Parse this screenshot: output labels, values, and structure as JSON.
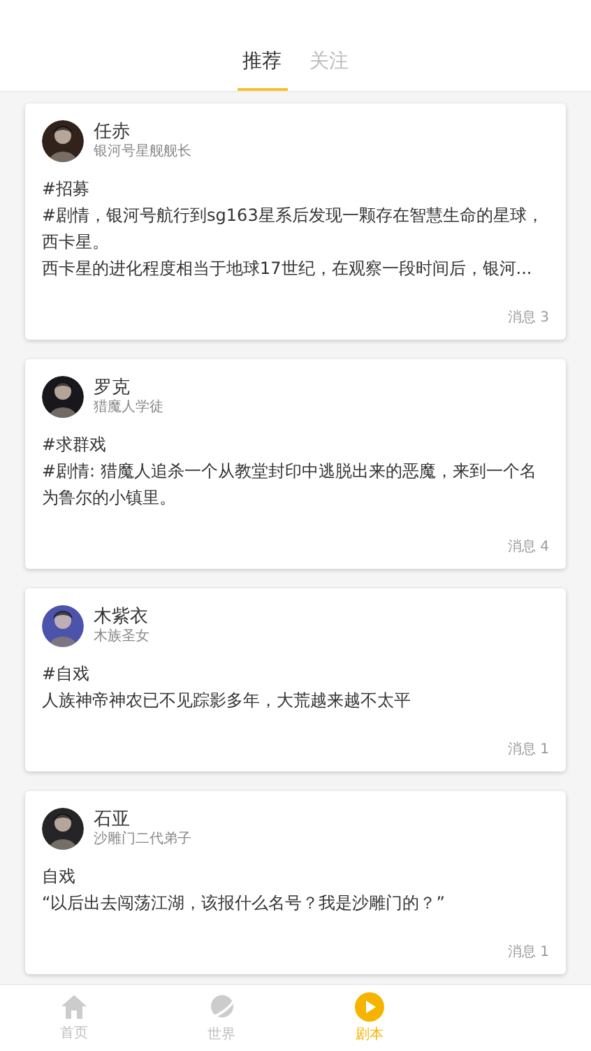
{
  "tabs": [
    {
      "label": "推荐",
      "selected": true
    },
    {
      "label": "关注",
      "selected": false
    }
  ],
  "posts": [
    {
      "name": "任赤",
      "role": "银河号星舰舰长",
      "body": [
        "#招募",
        "#剧情，银河号航行到sg163星系后发现一颗存在智慧生命的星球，西卡星。",
        "西卡星的进化程度相当于地球17世纪，在观察一段时间后，银河..."
      ],
      "messages": "消息 3"
    },
    {
      "name": "罗克",
      "role": "猎魔人学徒",
      "body": [
        "#求群戏",
        "#剧情: 猎魔人追杀一个从教堂封印中逃脱出来的恶魔，来到一个名为鲁尔的小镇里。"
      ],
      "messages": "消息 4"
    },
    {
      "name": "木紫衣",
      "role": "木族圣女",
      "body": [
        "#自戏",
        "人族神帝神农已不见踪影多年，大荒越来越不太平"
      ],
      "messages": "消息 1"
    },
    {
      "name": "石亚",
      "role": "沙雕门二代弟子",
      "body": [
        "自戏",
        "“以后出去闯荡江湖，该报什么名号？我是沙雕门的？”"
      ],
      "messages": "消息 1"
    }
  ],
  "nav": [
    {
      "label": "首页",
      "selected": false
    },
    {
      "label": "世界",
      "selected": false
    },
    {
      "label": "剧本",
      "selected": true
    }
  ]
}
